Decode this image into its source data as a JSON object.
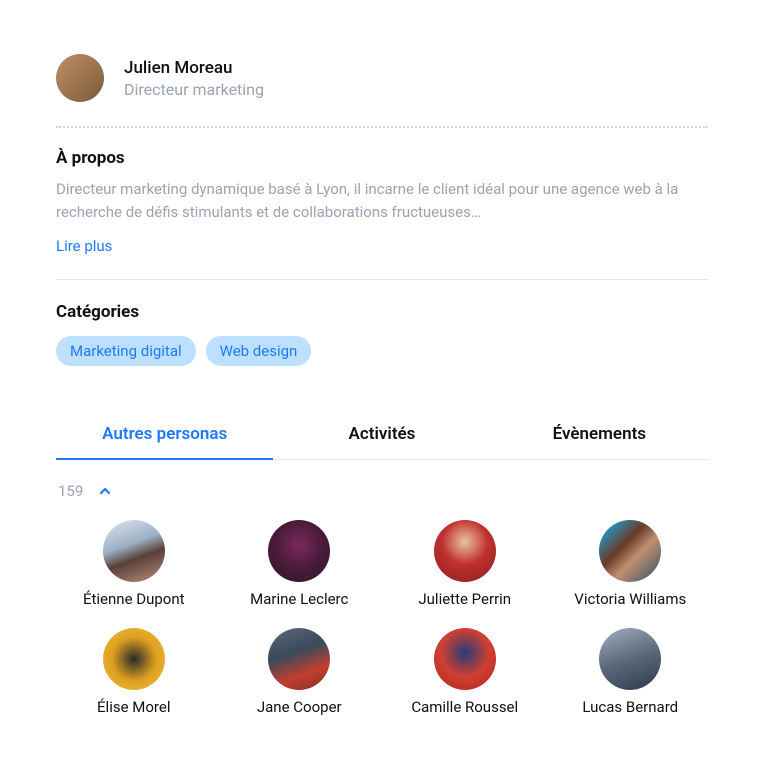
{
  "profile": {
    "name": "Julien Moreau",
    "role": "Directeur marketing"
  },
  "about": {
    "title": "À propos",
    "text": "Directeur marketing dynamique basé à Lyon, il incarne le client idéal pour une agence web à la recherche de défis stimulants et de collaborations fructueuses…",
    "readMore": "Lire plus"
  },
  "categories": {
    "title": "Catégories",
    "items": [
      "Marketing digital",
      "Web design"
    ]
  },
  "tabs": {
    "items": [
      {
        "label": "Autres personas",
        "active": true
      },
      {
        "label": "Activités",
        "active": false
      },
      {
        "label": "Évènements",
        "active": false
      }
    ]
  },
  "personas": {
    "count": "159",
    "items": [
      {
        "name": "Étienne Dupont"
      },
      {
        "name": "Marine Leclerc"
      },
      {
        "name": "Juliette Perrin"
      },
      {
        "name": "Victoria Williams"
      },
      {
        "name": "Élise Morel"
      },
      {
        "name": "Jane Cooper"
      },
      {
        "name": "Camille Roussel"
      },
      {
        "name": "Lucas Bernard"
      }
    ]
  }
}
